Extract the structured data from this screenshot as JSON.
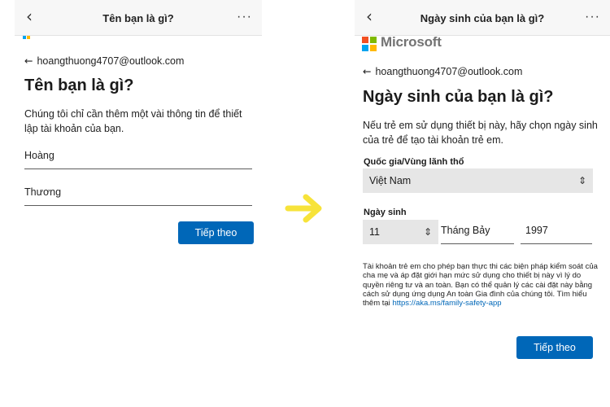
{
  "left": {
    "topbar": {
      "back_icon": "‹",
      "title": "Tên bạn là gì?",
      "more": "···"
    },
    "email": "hoangthuong4707@outlook.com",
    "heading": "Tên bạn là gì?",
    "description": "Chúng tôi chỉ cần thêm một vài thông tin để thiết lập tài khoản của bạn.",
    "first_name_value": "Hoàng",
    "last_name_value": "Thương",
    "next_button": "Tiếp theo"
  },
  "right": {
    "topbar": {
      "back_icon": "‹",
      "title": "Ngày sinh của bạn là gì?",
      "more": "···"
    },
    "brand": "Microsoft",
    "email": "hoangthuong4707@outlook.com",
    "heading": "Ngày sinh của bạn là gì?",
    "description": "Nếu trẻ em sử dụng thiết bị này, hãy chọn ngày sinh của trẻ để tạo tài khoản trẻ em.",
    "country_label": "Quốc gia/Vùng lãnh thổ",
    "country_value": "Việt Nam",
    "birthdate_label": "Ngày sinh",
    "day_value": "11",
    "month_value": "Tháng Bảy",
    "year_value": "1997",
    "notice_text": "Tài khoản trẻ em cho phép bạn thực thi các biện pháp kiểm soát của cha mẹ và áp đặt giới hạn mức sử dụng cho thiết bị này vì lý do quyền riêng tư và an toàn. Bạn có thể quản lý các cài đặt này bằng cách sử dụng ứng dụng An toàn Gia đình của chúng tôi. Tìm hiểu thêm tại ",
    "notice_link": "https://aka.ms/family-safety-app",
    "next_button": "Tiếp theo"
  },
  "colors": {
    "accent": "#0067b8",
    "arrow": "#f7e33a",
    "ms_red": "#f25022",
    "ms_green": "#7fba00",
    "ms_blue": "#00a4ef",
    "ms_yellow": "#ffb900"
  },
  "icons": {
    "back": "chevron-left-icon",
    "more": "more-horizontal-icon",
    "select": "chevron-up-down-icon",
    "transition": "arrow-right-icon"
  }
}
